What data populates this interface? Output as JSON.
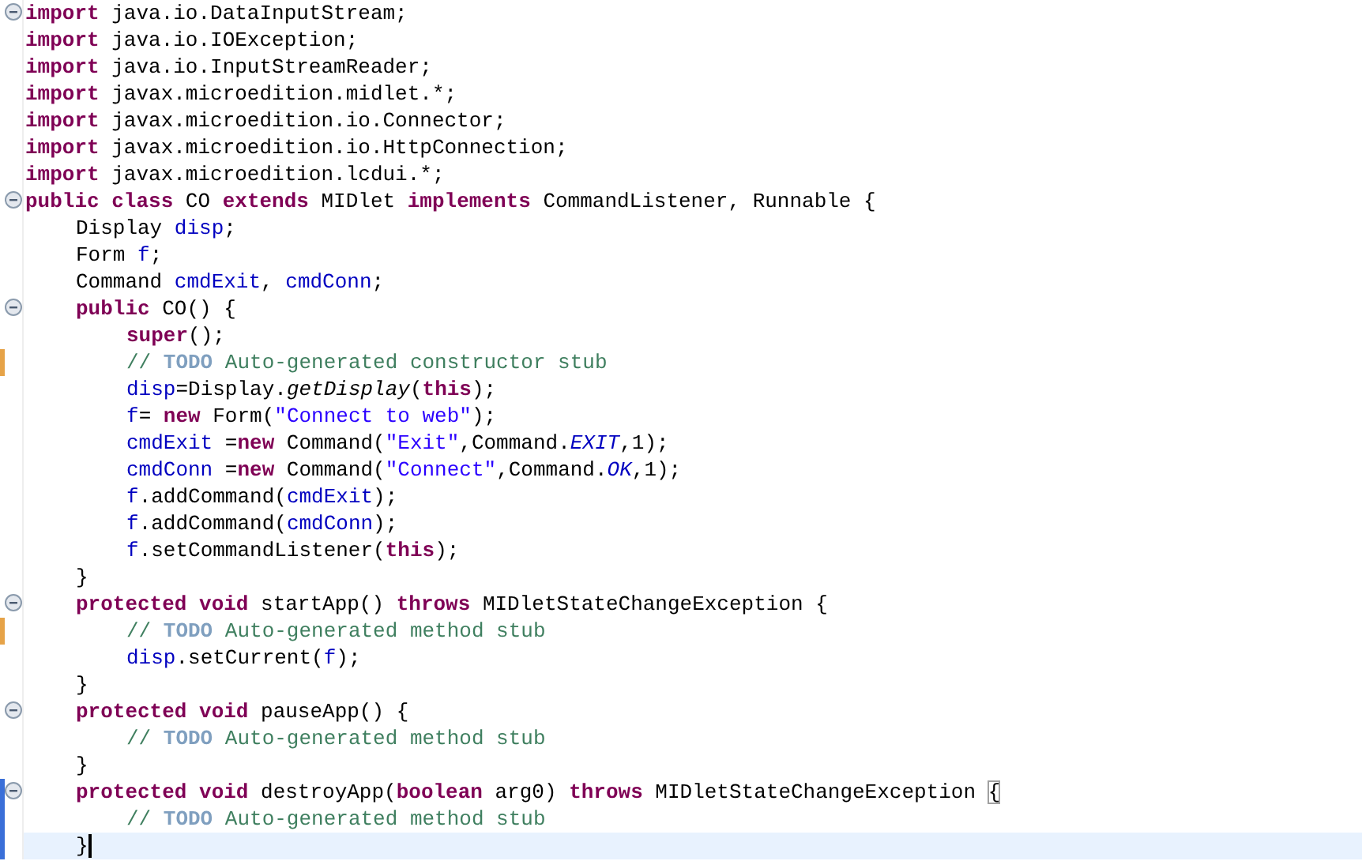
{
  "editor": {
    "lines": [
      {
        "fold": true,
        "current": false,
        "tokens": [
          {
            "kind": "keyword",
            "text": "import"
          },
          {
            "kind": "plain",
            "text": " java.io.DataInputStream;"
          }
        ]
      },
      {
        "fold": false,
        "current": false,
        "tokens": [
          {
            "kind": "keyword",
            "text": "import"
          },
          {
            "kind": "plain",
            "text": " java.io.IOException;"
          }
        ]
      },
      {
        "fold": false,
        "current": false,
        "tokens": [
          {
            "kind": "keyword",
            "text": "import"
          },
          {
            "kind": "plain",
            "text": " java.io.InputStreamReader;"
          }
        ]
      },
      {
        "fold": false,
        "current": false,
        "tokens": [
          {
            "kind": "keyword",
            "text": "import"
          },
          {
            "kind": "plain",
            "text": " javax.microedition.midlet.*;"
          }
        ]
      },
      {
        "fold": false,
        "current": false,
        "tokens": [
          {
            "kind": "keyword",
            "text": "import"
          },
          {
            "kind": "plain",
            "text": " javax.microedition.io.Connector;"
          }
        ]
      },
      {
        "fold": false,
        "current": false,
        "tokens": [
          {
            "kind": "keyword",
            "text": "import"
          },
          {
            "kind": "plain",
            "text": " javax.microedition.io.HttpConnection;"
          }
        ]
      },
      {
        "fold": false,
        "current": false,
        "tokens": [
          {
            "kind": "keyword",
            "text": "import"
          },
          {
            "kind": "plain",
            "text": " javax.microedition.lcdui.*;"
          }
        ]
      },
      {
        "fold": true,
        "current": false,
        "tokens": [
          {
            "kind": "keyword",
            "text": "public class"
          },
          {
            "kind": "plain",
            "text": " CO "
          },
          {
            "kind": "keyword",
            "text": "extends"
          },
          {
            "kind": "plain",
            "text": " MIDlet "
          },
          {
            "kind": "keyword",
            "text": "implements"
          },
          {
            "kind": "plain",
            "text": " CommandListener, Runnable {"
          }
        ],
        "children": [
          {
            "fold": false,
            "current": false,
            "tokens": [
              {
                "kind": "plain",
                "text": "Display "
              },
              {
                "kind": "field",
                "text": "disp"
              },
              {
                "kind": "plain",
                "text": ";"
              }
            ]
          },
          {
            "fold": false,
            "current": false,
            "tokens": [
              {
                "kind": "plain",
                "text": "Form "
              },
              {
                "kind": "field",
                "text": "f"
              },
              {
                "kind": "plain",
                "text": ";"
              }
            ]
          },
          {
            "fold": false,
            "current": false,
            "tokens": [
              {
                "kind": "plain",
                "text": "Command "
              },
              {
                "kind": "field",
                "text": "cmdExit"
              },
              {
                "kind": "plain",
                "text": ", "
              },
              {
                "kind": "field",
                "text": "cmdConn"
              },
              {
                "kind": "plain",
                "text": ";"
              }
            ]
          },
          {
            "fold": true,
            "current": false,
            "tokens": [
              {
                "kind": "keyword",
                "text": "public"
              },
              {
                "kind": "plain",
                "text": " CO() {"
              }
            ],
            "children": [
              {
                "fold": false,
                "current": false,
                "tokens": [
                  {
                    "kind": "keyword",
                    "text": "super"
                  },
                  {
                    "kind": "plain",
                    "text": "();"
                  }
                ]
              },
              {
                "fold": false,
                "current": false,
                "color": "#e6a348",
                "tokens": [
                  {
                    "kind": "comment",
                    "text": "// "
                  },
                  {
                    "kind": "todo",
                    "text": "TODO"
                  },
                  {
                    "kind": "comment",
                    "text": " Auto-generated constructor stub"
                  }
                ]
              },
              {
                "fold": false,
                "current": false,
                "tokens": [
                  {
                    "kind": "field",
                    "text": "disp"
                  },
                  {
                    "kind": "plain",
                    "text": "=Display."
                  },
                  {
                    "kind": "method",
                    "text": "getDisplay"
                  },
                  {
                    "kind": "plain",
                    "text": "("
                  },
                  {
                    "kind": "keyword",
                    "text": "this"
                  },
                  {
                    "kind": "plain",
                    "text": ");"
                  }
                ]
              },
              {
                "fold": false,
                "current": false,
                "tokens": [
                  {
                    "kind": "field",
                    "text": "f"
                  },
                  {
                    "kind": "plain",
                    "text": "= "
                  },
                  {
                    "kind": "keyword",
                    "text": "new"
                  },
                  {
                    "kind": "plain",
                    "text": " Form("
                  },
                  {
                    "kind": "string",
                    "text": "\"Connect to web\""
                  },
                  {
                    "kind": "plain",
                    "text": ");"
                  }
                ]
              },
              {
                "fold": false,
                "current": false,
                "tokens": [
                  {
                    "kind": "field",
                    "text": "cmdExit"
                  },
                  {
                    "kind": "plain",
                    "text": " ="
                  },
                  {
                    "kind": "keyword",
                    "text": "new"
                  },
                  {
                    "kind": "plain",
                    "text": " Command("
                  },
                  {
                    "kind": "string",
                    "text": "\"Exit\""
                  },
                  {
                    "kind": "plain",
                    "text": ",Command."
                  },
                  {
                    "kind": "constant",
                    "text": "EXIT"
                  },
                  {
                    "kind": "plain",
                    "text": ",1);"
                  }
                ]
              },
              {
                "fold": false,
                "current": false,
                "tokens": [
                  {
                    "kind": "field",
                    "text": "cmdConn"
                  },
                  {
                    "kind": "plain",
                    "text": " ="
                  },
                  {
                    "kind": "keyword",
                    "text": "new"
                  },
                  {
                    "kind": "plain",
                    "text": " Command("
                  },
                  {
                    "kind": "string",
                    "text": "\"Connect\""
                  },
                  {
                    "kind": "plain",
                    "text": ",Command."
                  },
                  {
                    "kind": "constant",
                    "text": "OK"
                  },
                  {
                    "kind": "plain",
                    "text": ",1);"
                  }
                ]
              },
              {
                "fold": false,
                "current": false,
                "tokens": [
                  {
                    "kind": "field",
                    "text": "f"
                  },
                  {
                    "kind": "plain",
                    "text": ".addCommand("
                  },
                  {
                    "kind": "field",
                    "text": "cmdExit"
                  },
                  {
                    "kind": "plain",
                    "text": ");"
                  }
                ]
              },
              {
                "fold": false,
                "current": false,
                "tokens": [
                  {
                    "kind": "field",
                    "text": "f"
                  },
                  {
                    "kind": "plain",
                    "text": ".addCommand("
                  },
                  {
                    "kind": "field",
                    "text": "cmdConn"
                  },
                  {
                    "kind": "plain",
                    "text": ");"
                  }
                ]
              },
              {
                "fold": false,
                "current": false,
                "tokens": [
                  {
                    "kind": "field",
                    "text": "f"
                  },
                  {
                    "kind": "plain",
                    "text": ".setCommandListener("
                  },
                  {
                    "kind": "keyword",
                    "text": "this"
                  },
                  {
                    "kind": "plain",
                    "text": ");"
                  }
                ]
              }
            ]
          },
          {
            "fold": false,
            "current": false,
            "tokens": [
              {
                "kind": "plain",
                "text": "}"
              }
            ]
          },
          {
            "fold": true,
            "current": false,
            "tokens": [
              {
                "kind": "keyword",
                "text": "protected void"
              },
              {
                "kind": "plain",
                "text": " startApp() "
              },
              {
                "kind": "keyword",
                "text": "throws"
              },
              {
                "kind": "plain",
                "text": " MIDletStateChangeException {"
              }
            ],
            "children": [
              {
                "fold": false,
                "current": false,
                "color": "#e6a348",
                "tokens": [
                  {
                    "kind": "comment",
                    "text": "// "
                  },
                  {
                    "kind": "todo",
                    "text": "TODO"
                  },
                  {
                    "kind": "comment",
                    "text": " Auto-generated method stub"
                  }
                ]
              },
              {
                "fold": false,
                "current": false,
                "tokens": [
                  {
                    "kind": "field",
                    "text": "disp"
                  },
                  {
                    "kind": "plain",
                    "text": ".setCurrent("
                  },
                  {
                    "kind": "field",
                    "text": "f"
                  },
                  {
                    "kind": "plain",
                    "text": ");"
                  }
                ]
              }
            ]
          },
          {
            "fold": false,
            "current": false,
            "tokens": [
              {
                "kind": "plain",
                "text": "}"
              }
            ]
          },
          {
            "fold": true,
            "current": false,
            "tokens": [
              {
                "kind": "keyword",
                "text": "protected void"
              },
              {
                "kind": "plain",
                "text": " pauseApp() {"
              }
            ],
            "children": [
              {
                "fold": false,
                "current": false,
                "tokens": [
                  {
                    "kind": "comment",
                    "text": "// "
                  },
                  {
                    "kind": "todo",
                    "text": "TODO"
                  },
                  {
                    "kind": "comment",
                    "text": " Auto-generated method stub"
                  }
                ]
              }
            ]
          },
          {
            "fold": false,
            "current": false,
            "tokens": [
              {
                "kind": "plain",
                "text": "}"
              }
            ]
          },
          {
            "fold": true,
            "current": false,
            "color": "#3a6fd8",
            "tokens": [
              {
                "kind": "keyword",
                "text": "protected void"
              },
              {
                "kind": "plain",
                "text": " destroyApp("
              },
              {
                "kind": "keyword",
                "text": "boolean"
              },
              {
                "kind": "plain",
                "text": " arg0) "
              },
              {
                "kind": "keyword",
                "text": "throws"
              },
              {
                "kind": "plain",
                "text": " MIDletStateChangeException "
              },
              {
                "kind": "matched-bracket",
                "text": "{"
              }
            ],
            "children": [
              {
                "fold": false,
                "current": false,
                "color": "#3a6fd8",
                "tokens": [
                  {
                    "kind": "comment",
                    "text": "// "
                  },
                  {
                    "kind": "todo",
                    "text": "TODO"
                  },
                  {
                    "kind": "comment",
                    "text": " Auto-generated method stub"
                  }
                ]
              }
            ]
          },
          {
            "fold": false,
            "current": true,
            "color": "#3a6fd8",
            "tokens": [
              {
                "kind": "plain",
                "text": "}"
              }
            ]
          }
        ]
      }
    ]
  }
}
